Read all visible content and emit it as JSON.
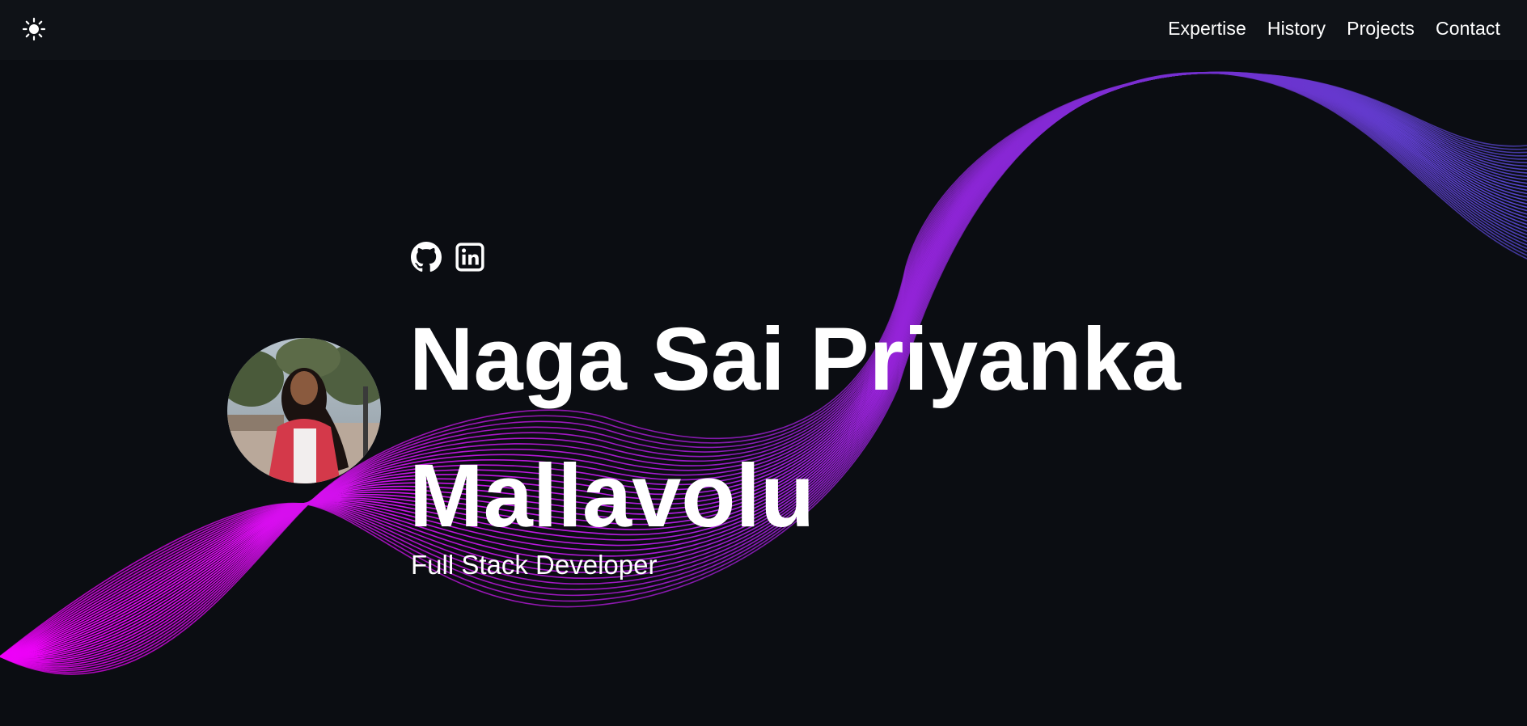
{
  "header": {
    "theme_toggle_icon": "sun-icon",
    "nav": [
      {
        "label": "Expertise"
      },
      {
        "label": "History"
      },
      {
        "label": "Projects"
      },
      {
        "label": "Contact"
      }
    ]
  },
  "hero": {
    "socials": [
      {
        "icon": "github-icon"
      },
      {
        "icon": "linkedin-icon"
      }
    ],
    "name": "Naga Sai Priyanka Mallavolu",
    "role": "Full Stack Developer"
  },
  "colors": {
    "background": "#0b0d12",
    "header": "#0f1217",
    "wave_magenta": "#e400f6",
    "wave_purple": "#7a2bd8",
    "wave_blue": "#5a3fd0"
  }
}
